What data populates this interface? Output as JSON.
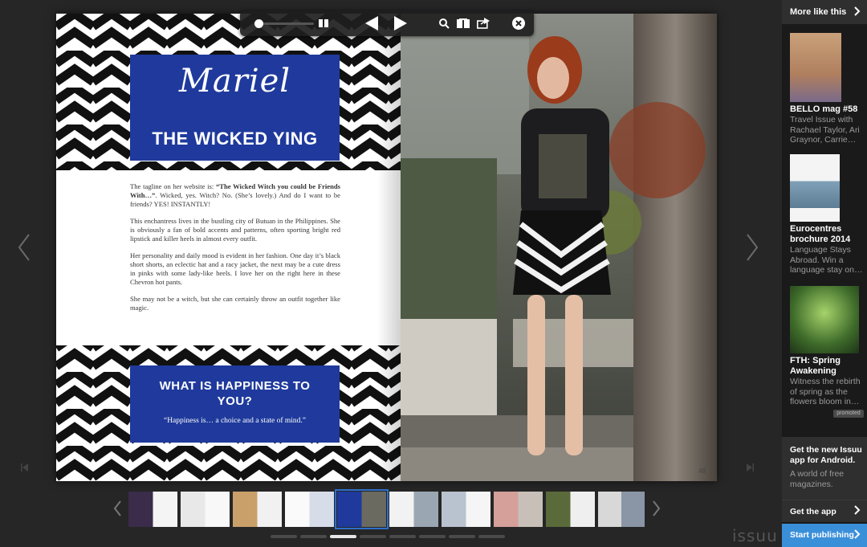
{
  "spread": {
    "left_page": {
      "script_title": "Mariel",
      "title": "THE WICKED YING",
      "paragraphs": [
        {
          "lead": "The tagline on her website is: ",
          "bold": "“The Wicked Witch you could be Friends With…”",
          "rest": ". Wicked, yes. Witch? No. (She’s lovely.) And do I want to be friends? YES! INSTANTLY!"
        },
        {
          "lead": "This enchantress lives in the bustling city of Butuan in the Philippines. She is obviously a fan of bold accents and patterns, often sporting bright red lipstick and killer heels in almost every outfit.",
          "bold": "",
          "rest": ""
        },
        {
          "lead": "Her personality and daily mood is evident in her fashion. One day it’s black short shorts, an eclectic hat and a racy jacket, the next may be a cute dress in pinks with some lady-like heels. I love her on the right here in these Chevron hot pants.",
          "bold": "",
          "rest": ""
        },
        {
          "lead": "She may not be a witch, but she can certainly throw an outfit together like magic.",
          "bold": "",
          "rest": ""
        }
      ],
      "question_title": "WHAT IS HAPPINESS TO YOU?",
      "question_answer": "“Happiness is… a choice and a state of mind.”"
    },
    "right_page": {
      "page_number": "49"
    }
  },
  "toolbar": {
    "zoom_icon": "zoom-slider",
    "icons": [
      "two-page-view-icon",
      "previous-page-icon",
      "next-page-icon",
      "search-icon",
      "stack-icon",
      "share-icon",
      "close-icon"
    ]
  },
  "thumbnails": {
    "count": 10,
    "active_index": 4
  },
  "pagination": {
    "dots": 8,
    "active_index": 2
  },
  "brand": "issuu",
  "sidebar": {
    "header": "More like this",
    "items": [
      {
        "title": "BELLO mag #58",
        "desc": "Travel Issue with Rachael Taylor, Ari Graynor, Carrie…",
        "promoted": ""
      },
      {
        "title": "Eurocentres brochure 2014",
        "desc": "Language Stays Abroad. Win a language stay on…",
        "promoted": ""
      },
      {
        "title": "FTH: Spring Awakening",
        "desc": "Witness the rebirth of spring as the flowers bloom in…",
        "promoted": "promoted"
      }
    ],
    "app_promo": {
      "title": "Get the new Issuu app for Android.",
      "desc": "A world of free magazines.",
      "cta": "Get the app"
    },
    "publish_cta": "Start publishing"
  },
  "colors": {
    "accent_blue": "#1f3a9c",
    "publish_blue": "#3a8fd9",
    "background": "#262626"
  }
}
